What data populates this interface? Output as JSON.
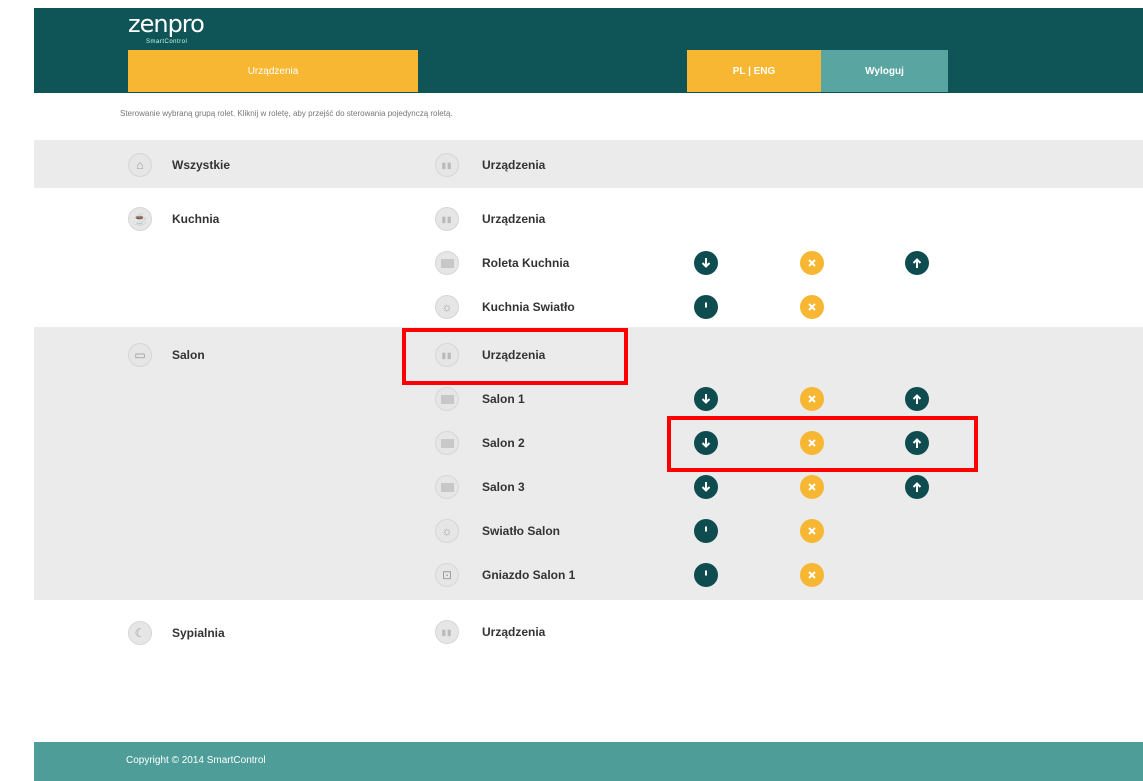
{
  "header": {
    "logo_main": "zenpro",
    "logo_sub": "SmartControl",
    "tab_devices": "Urządzenia",
    "tab_lang": "PL | ENG",
    "tab_logout": "Wyloguj",
    "subtitle": "Sterowanie wybraną grupą rolet. Kliknij w roletę, aby przejść do sterowania pojedynczą roletą."
  },
  "groups": [
    {
      "label": "Wszystkie",
      "icon": "home-icon",
      "devices": [
        {
          "label": "Urządzenia",
          "icon": "grid-icon",
          "controls": "none"
        }
      ]
    },
    {
      "label": "Kuchnia",
      "icon": "kitchen-icon",
      "devices": [
        {
          "label": "Urządzenia",
          "icon": "grid-icon",
          "controls": "none"
        },
        {
          "label": "Roleta Kuchnia",
          "icon": "blind-icon",
          "controls": "blind"
        },
        {
          "label": "Kuchnia Swiatło",
          "icon": "bulb-icon",
          "controls": "switch"
        }
      ]
    },
    {
      "label": "Salon",
      "icon": "tv-icon",
      "devices": [
        {
          "label": "Urządzenia",
          "icon": "grid-icon",
          "controls": "none"
        },
        {
          "label": "Salon 1",
          "icon": "blind-icon",
          "controls": "blind"
        },
        {
          "label": "Salon 2",
          "icon": "blind-icon",
          "controls": "blind"
        },
        {
          "label": "Salon 3",
          "icon": "blind-icon",
          "controls": "blind"
        },
        {
          "label": "Swiatło Salon",
          "icon": "bulb-icon",
          "controls": "switch"
        },
        {
          "label": "Gniazdo Salon 1",
          "icon": "socket-icon",
          "controls": "switch"
        }
      ]
    },
    {
      "label": "Sypialnia",
      "icon": "moon-icon",
      "devices": [
        {
          "label": "Urządzenia",
          "icon": "grid-icon",
          "controls": "none"
        }
      ]
    }
  ],
  "footer": {
    "copyright": "Copyright © 2014 SmartControl"
  },
  "colors": {
    "header": "#0f5457",
    "accent": "#f7b733",
    "teal": "#59a5a1",
    "dark_button": "#0f4c50",
    "footer": "#4e9d99",
    "highlight": "#ff0000"
  }
}
